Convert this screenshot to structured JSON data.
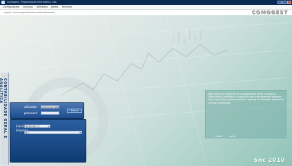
{
  "window": {
    "title": "Comogest - Programação Informática, Lda",
    "buttons": [
      "minimize",
      "maximize",
      "close"
    ]
  },
  "menu": {
    "items": [
      "Configurações",
      "Serviços",
      "Utilitários",
      "Janela",
      "Terminar"
    ]
  },
  "brand": {
    "logo": "COMOGEST",
    "version": "Snc 2010"
  },
  "pathbar": {
    "label": "Ligação:",
    "value": "C:\\Comogest\\Dados\\Contabilidade\\2010"
  },
  "sidebar": {
    "vertical_label": "CONTABILIDADE GERAL E ANALÍTICA"
  },
  "login": {
    "user_label": "utilizador",
    "user_value": "Administrador",
    "password_label": "password",
    "password_value": "",
    "enter_label": "Entrar"
  },
  "company": {
    "year_label": "Exercício",
    "year_value": "2010 08-11",
    "company_label": "Empresa",
    "company_value": "01"
  },
  "notice": {
    "text": "Bem-vindo ao programa de Contabilidade Geral e Analítica. Seleccione a empresa e o exercício com que pretende trabalhar. Para mais informações consulte o manual de utilização disponível no menu Utilitários.",
    "ok_label": "Aceitar",
    "cancel_label": "Fechar"
  },
  "colors": {
    "title_bar": "#0b2a52",
    "panel_blue": "#1b4c8d",
    "accent_teal": "#8fc4b8"
  }
}
